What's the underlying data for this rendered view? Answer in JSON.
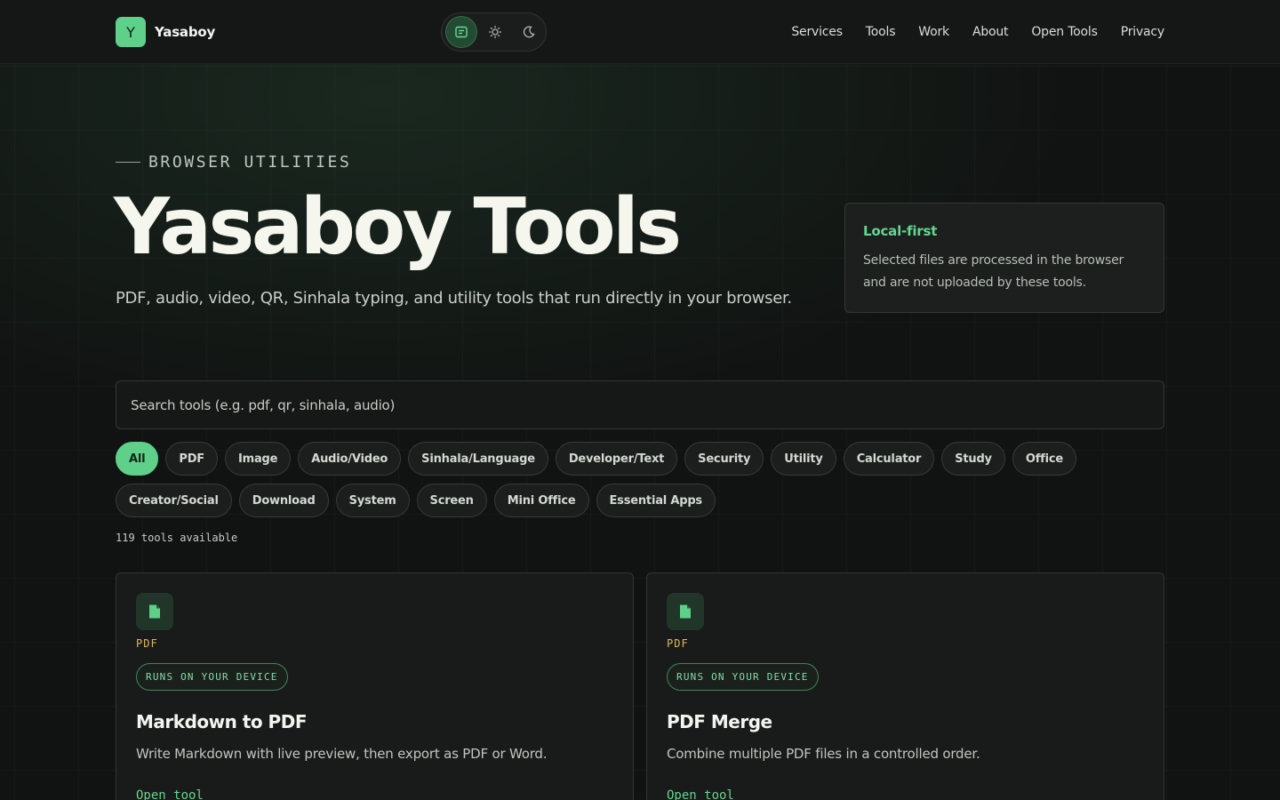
{
  "brand": {
    "logo_letter": "Y",
    "name": "Yasaboy"
  },
  "theme_switch": [
    {
      "icon": "reader-mode-icon",
      "active": true
    },
    {
      "icon": "sun-icon",
      "active": false
    },
    {
      "icon": "moon-icon",
      "active": false
    }
  ],
  "nav": [
    "Services",
    "Tools",
    "Work",
    "About",
    "Open Tools",
    "Privacy"
  ],
  "hero": {
    "eyebrow": "BROWSER UTILITIES",
    "title": "Yasaboy Tools",
    "subtitle": "PDF, audio, video, QR, Sinhala typing, and utility tools that run directly in your browser."
  },
  "local_card": {
    "title": "Local-first",
    "text": "Selected files are processed in the browser and are not uploaded by these tools."
  },
  "search": {
    "placeholder": "Search tools (e.g. pdf, qr, sinhala, audio)",
    "value": ""
  },
  "filters": {
    "active": "All",
    "items": [
      "All",
      "PDF",
      "Image",
      "Audio/Video",
      "Sinhala/Language",
      "Developer/Text",
      "Security",
      "Utility",
      "Calculator",
      "Study",
      "Office",
      "Creator/Social",
      "Download",
      "System",
      "Screen",
      "Mini Office",
      "Essential Apps"
    ]
  },
  "count_text": "119 tools available",
  "tools": [
    {
      "icon": "document-icon",
      "category": "PDF",
      "badge": "RUNS ON YOUR DEVICE",
      "title": "Markdown to PDF",
      "description": "Write Markdown with live preview, then export as PDF or Word.",
      "link_label": "Open tool"
    },
    {
      "icon": "document-icon",
      "category": "PDF",
      "badge": "RUNS ON YOUR DEVICE",
      "title": "PDF Merge",
      "description": "Combine multiple PDF files in a controlled order.",
      "link_label": "Open tool"
    }
  ],
  "colors": {
    "accent": "#5fd08a",
    "category": "#e2b45a",
    "background": "#111312"
  }
}
